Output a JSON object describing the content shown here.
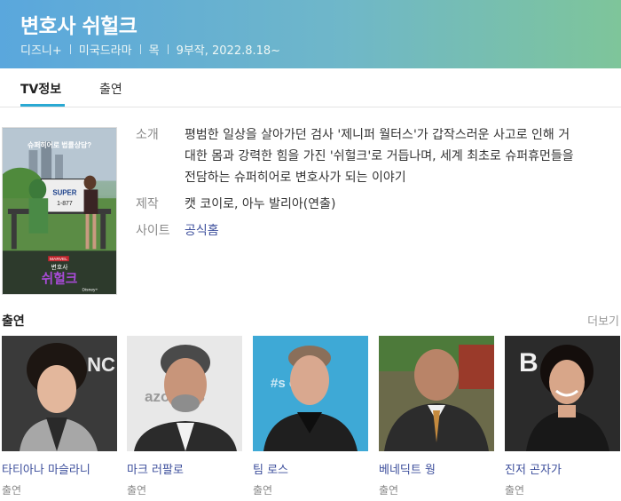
{
  "header": {
    "title": "변호사 쉬헐크",
    "meta": [
      "디즈니+",
      "미국드라마",
      "목",
      "9부작, 2022.8.18~"
    ]
  },
  "tabs": [
    {
      "label": "TV정보",
      "active": true
    },
    {
      "label": "출연",
      "active": false
    }
  ],
  "poster": {
    "tagline": "슈퍼히어로 법률상담?",
    "title_small": "변호사",
    "title_big": "쉬헐크",
    "brand": "MARVEL",
    "service": "Disney+"
  },
  "info": {
    "intro_label": "소개",
    "intro_lines": [
      "평범한 일상을 살아가던 검사 '제니퍼 월터스'가 갑작스러운 사고로 인해 거",
      "대한 몸과 강력한 힘을 가진 '쉬헐크'로 거듭나며, 세계 최초로 슈퍼휴먼들을",
      "전담하는 슈퍼히어로 변호사가 되는 이야기"
    ],
    "production_label": "제작",
    "production_value": "캣 코이로, 아누 발리아(연출)",
    "site_label": "사이트",
    "site_value": "공식홈"
  },
  "cast": {
    "title": "출연",
    "more": "더보기",
    "members": [
      {
        "name": "타티아나 마슬라니",
        "role": "출연",
        "bg": "#3a3a3a",
        "bg_text": "NC"
      },
      {
        "name": "마크 러팔로",
        "role": "출연",
        "bg": "#e8e8e8",
        "bg_text": "azon OS"
      },
      {
        "name": "팀 로스",
        "role": "출연",
        "bg": "#3ea9d6",
        "bg_text": "#s ce"
      },
      {
        "name": "베네딕트 웡",
        "role": "출연",
        "bg": "#6b6a4a",
        "bg_text": ""
      },
      {
        "name": "진저 곤자가",
        "role": "출연",
        "bg": "#2b2b2b",
        "bg_text": "B"
      }
    ]
  },
  "colors": {
    "accent": "#2aa9d3",
    "link": "#3d4f9c",
    "banner_start": "#5aa7dd",
    "banner_end": "#7ec59a"
  }
}
